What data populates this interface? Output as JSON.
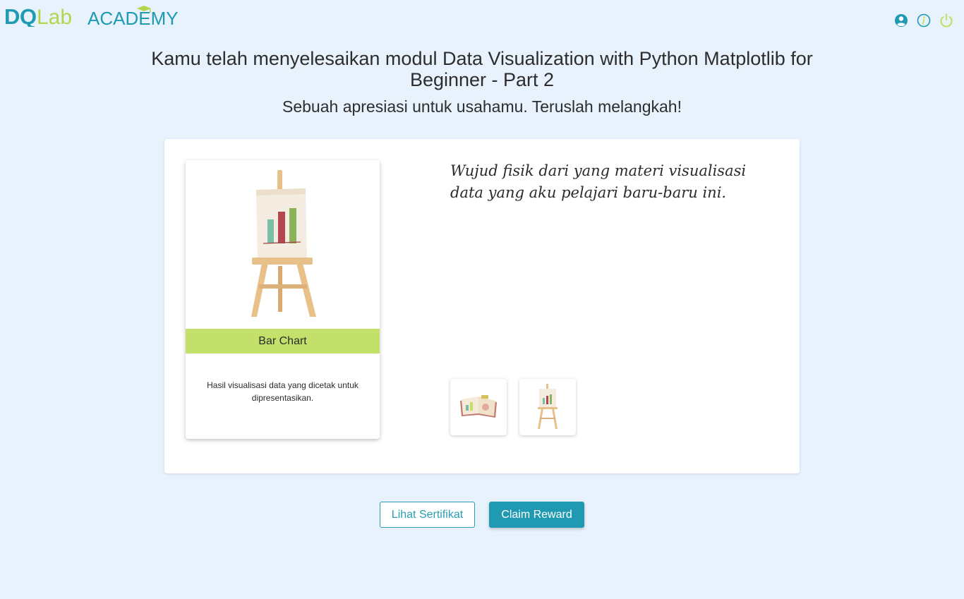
{
  "brand": {
    "logo_text": "DQLab",
    "logo_suffix": "ACADEMY",
    "color_primary": "#1f9ab2",
    "color_accent": "#c2e06a"
  },
  "header": {
    "icons": [
      "user-icon",
      "info-icon",
      "power-icon"
    ]
  },
  "completion": {
    "title": "Kamu telah menyelesaikan modul Data Visualization with Python Matplotlib for Beginner - Part 2",
    "subtitle": "Sebuah apresiasi untuk usahamu. Teruslah melangkah!"
  },
  "reward_card": {
    "name": "Bar Chart",
    "description": "Hasil visualisasi data yang dicetak untuk dipresentasikan.",
    "image_icon": "easel-bar-chart-icon"
  },
  "quote": "Wujud fisik dari yang materi visualisasi data yang aku pelajari baru-baru ini.",
  "thumbnails": [
    {
      "icon": "book-chart-icon"
    },
    {
      "icon": "easel-bar-chart-icon"
    }
  ],
  "actions": {
    "certificate_label": "Lihat Sertifikat",
    "claim_label": "Claim Reward"
  }
}
